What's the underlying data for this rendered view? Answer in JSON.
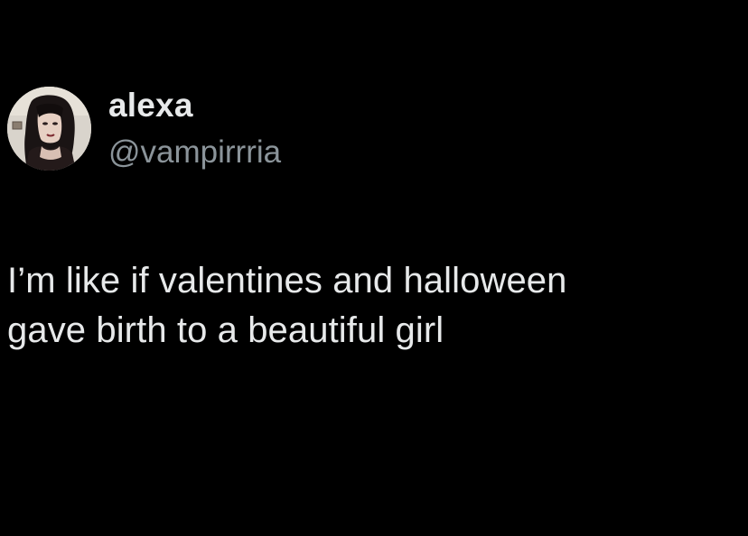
{
  "tweet": {
    "author": {
      "display_name": "alexa",
      "handle": "@vampirrria",
      "avatar_icon": "profile-photo"
    },
    "text": "I’m like if valentines and halloween\ngave birth to a beautiful girl"
  },
  "colors": {
    "background": "#000000",
    "primary_text": "#e7e9ea",
    "secondary_text": "#8b949a"
  }
}
